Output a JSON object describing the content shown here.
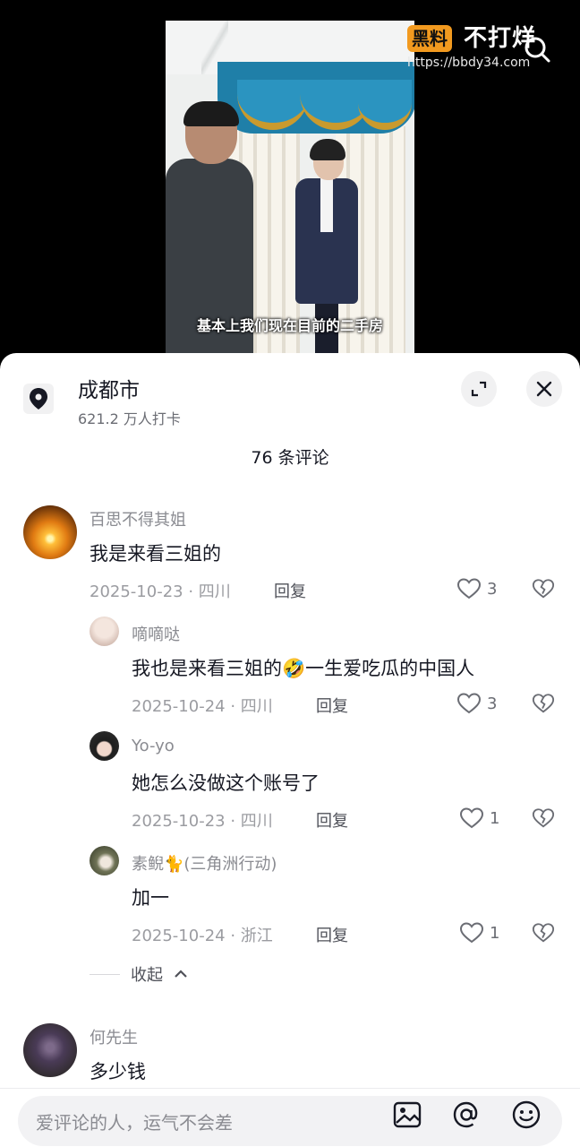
{
  "video": {
    "subtitle": "基本上我们现在目前的二手房"
  },
  "watermark": {
    "tag": "黑料",
    "brand": "不打烊",
    "url": "https://bbdy34.com"
  },
  "location": {
    "title": "成都市",
    "subtitle": "621.2 万人打卡"
  },
  "comments_count": "76 条评论",
  "comments": [
    {
      "name": "百思不得其姐",
      "text": "我是来看三姐的",
      "meta": "2025-10-23 · 四川",
      "reply": "回复",
      "likes": "3"
    },
    {
      "name": "嘀嘀哒",
      "text": "我也是来看三姐的🤣一生爱吃瓜的中国人",
      "meta": "2025-10-24 · 四川",
      "reply": "回复",
      "likes": "3"
    },
    {
      "name": "Yo-yo",
      "text": "她怎么没做这个账号了",
      "meta": "2025-10-23 · 四川",
      "reply": "回复",
      "likes": "1"
    },
    {
      "name": "素鲵🐈(三角洲行动)",
      "text": "加一",
      "meta": "2025-10-24 · 浙江",
      "reply": "回复",
      "likes": "1"
    },
    {
      "name": "何先生",
      "text": "多少钱"
    }
  ],
  "collapse_label": "收起",
  "input": {
    "placeholder": "爱评论的人，运气不会差"
  },
  "icons": [
    "search-icon",
    "location-pin-icon",
    "expand-icon",
    "close-icon",
    "heart-icon",
    "broken-heart-icon",
    "chevron-up-icon",
    "image-icon",
    "at-icon",
    "emoji-icon"
  ]
}
